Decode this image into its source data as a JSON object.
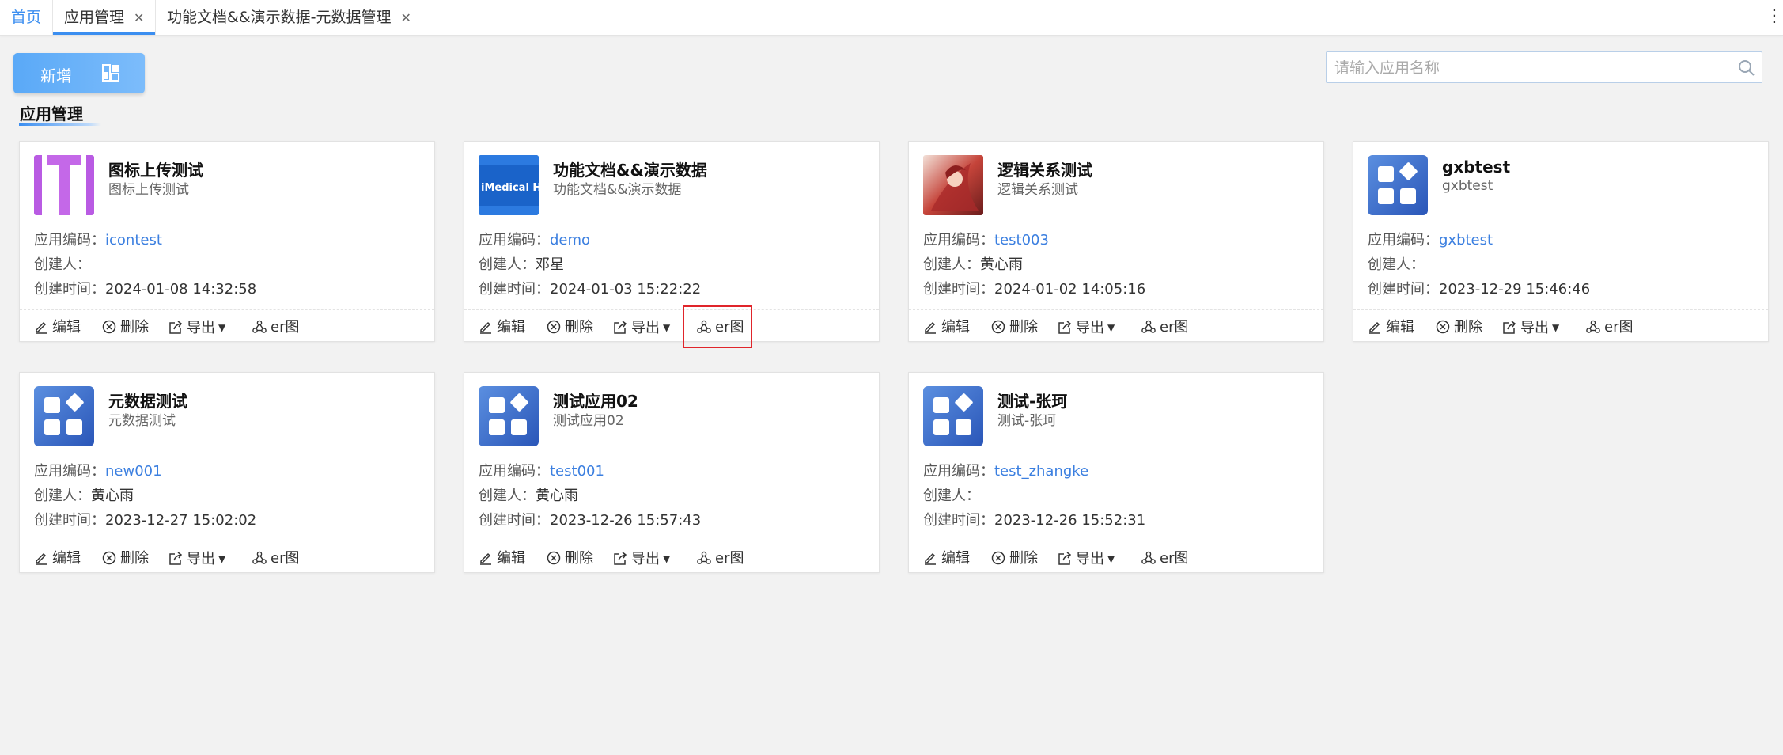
{
  "tabs": {
    "home": "首页",
    "items": [
      {
        "label": "应用管理",
        "active": true
      },
      {
        "label": "功能文档&&演示数据-元数据管理",
        "active": false
      }
    ],
    "close_glyph": "✕"
  },
  "toolbar": {
    "add_label": "新增",
    "search_placeholder": "请输入应用名称"
  },
  "section_title": "应用管理",
  "labels": {
    "code": "应用编码：",
    "creator": "创建人：",
    "created_time": "创建时间："
  },
  "actions": {
    "edit": "编辑",
    "delete": "删除",
    "export": "导出",
    "er": "er图"
  },
  "apps": [
    {
      "name": "图标上传测试",
      "subtitle": "图标上传测试",
      "code": "icontest",
      "creator": "",
      "created_time": "2024-01-08 14:32:58",
      "icon": "purple-logo-icon"
    },
    {
      "name": "功能文档&&演示数据",
      "subtitle": "功能文档&&演示数据",
      "code": "demo",
      "creator": "邓星",
      "created_time": "2024-01-03 15:22:22",
      "icon": "imedical-logo-icon",
      "icon_text": "iMedical HO"
    },
    {
      "name": "逻辑关系测试",
      "subtitle": "逻辑关系测试",
      "code": "test003",
      "creator": "黄心雨",
      "created_time": "2024-01-02 14:05:16",
      "icon": "anime-artwork-icon"
    },
    {
      "name": "gxbtest",
      "subtitle": "gxbtest",
      "code": "gxbtest",
      "creator": "",
      "created_time": "2023-12-29 15:46:46",
      "icon": "app-grid-icon"
    },
    {
      "name": "元数据测试",
      "subtitle": "元数据测试",
      "code": "new001",
      "creator": "黄心雨",
      "created_time": "2023-12-27 15:02:02",
      "icon": "app-grid-icon"
    },
    {
      "name": "测试应用02",
      "subtitle": "测试应用02",
      "code": "test001",
      "creator": "黄心雨",
      "created_time": "2023-12-26 15:57:43",
      "icon": "app-grid-icon"
    },
    {
      "name": "测试-张珂",
      "subtitle": "测试-张珂",
      "code": "test_zhangke",
      "creator": "",
      "created_time": "2023-12-26 15:52:31",
      "icon": "app-grid-icon"
    }
  ],
  "colors": {
    "accent": "#3b8ef0",
    "highlight": "#e0252b",
    "link": "#3b7fe0"
  }
}
